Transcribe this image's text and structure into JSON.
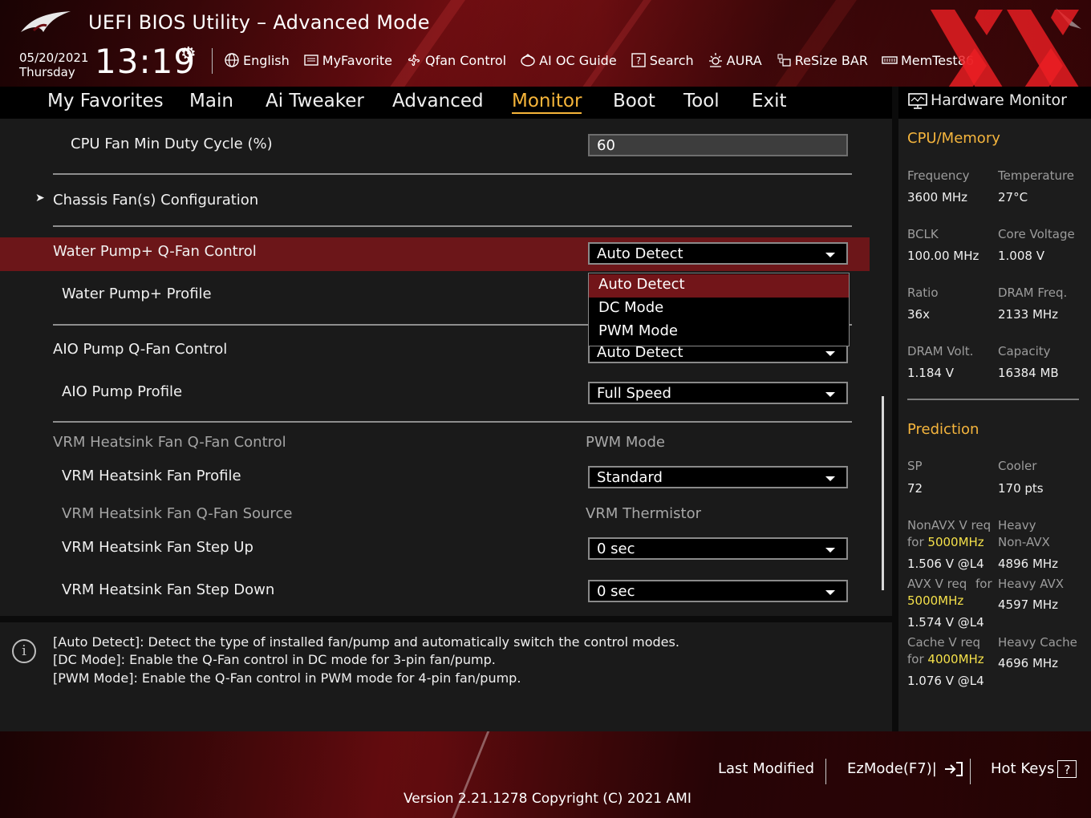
{
  "header": {
    "title": "UEFI BIOS Utility – Advanced Mode",
    "date": "05/20/2021",
    "weekday": "Thursday",
    "time": "13:19",
    "toolbar": [
      {
        "label": "English",
        "icon": "globe-icon"
      },
      {
        "label": "MyFavorite",
        "icon": "favorite-list-icon"
      },
      {
        "label": "Qfan Control",
        "icon": "fan-icon"
      },
      {
        "label": "AI OC Guide",
        "icon": "ai-oc-icon"
      },
      {
        "label": "Search",
        "icon": "search-question-icon"
      },
      {
        "label": "AURA",
        "icon": "aura-light-icon"
      },
      {
        "label": "ReSize BAR",
        "icon": "resize-bar-icon"
      },
      {
        "label": "MemTest86",
        "icon": "memtest-icon"
      }
    ]
  },
  "nav": {
    "tabs": [
      "My Favorites",
      "Main",
      "Ai Tweaker",
      "Advanced",
      "Monitor",
      "Boot",
      "Tool",
      "Exit"
    ],
    "active": "Monitor"
  },
  "settings": {
    "cpu_fan_min_duty": {
      "label": "CPU Fan Min Duty Cycle (%)",
      "value": "60"
    },
    "chassis_fans": {
      "label": "Chassis Fan(s) Configuration"
    },
    "water_pump_control": {
      "label": "Water Pump+ Q-Fan Control",
      "value": "Auto Detect"
    },
    "water_pump_profile": {
      "label": "Water Pump+ Profile"
    },
    "aio_pump_control": {
      "label": "AIO Pump Q-Fan Control",
      "value": "Auto Detect"
    },
    "aio_pump_profile": {
      "label": "AIO Pump Profile",
      "value": "Full Speed"
    },
    "vrm_control": {
      "label": "VRM Heatsink Fan Q-Fan Control",
      "value": "PWM Mode"
    },
    "vrm_profile": {
      "label": "VRM Heatsink Fan Profile",
      "value": "Standard"
    },
    "vrm_source": {
      "label": "VRM Heatsink Fan Q-Fan Source",
      "value": "VRM Thermistor"
    },
    "vrm_step_up": {
      "label": "VRM Heatsink Fan Step Up",
      "value": "0 sec"
    },
    "vrm_step_down": {
      "label": "VRM Heatsink Fan Step Down",
      "value": "0 sec"
    }
  },
  "dropdown": {
    "options": [
      "Auto Detect",
      "DC Mode",
      "PWM Mode"
    ],
    "selected": "Auto Detect"
  },
  "help": {
    "lines": [
      "[Auto Detect]: Detect the type of installed fan/pump and automatically switch the control modes.",
      "[DC Mode]: Enable the Q-Fan control in DC mode for 3-pin fan/pump.",
      "[PWM Mode]: Enable the Q-Fan control in PWM mode for 4-pin fan/pump."
    ]
  },
  "hardware_monitor": {
    "title": "Hardware Monitor",
    "cpu_memory": {
      "heading": "CPU/Memory",
      "frequency": {
        "label": "Frequency",
        "value": "3600 MHz"
      },
      "temperature": {
        "label": "Temperature",
        "value": "27°C"
      },
      "bclk": {
        "label": "BCLK",
        "value": "100.00 MHz"
      },
      "core_voltage": {
        "label": "Core Voltage",
        "value": "1.008 V"
      },
      "ratio": {
        "label": "Ratio",
        "value": "36x"
      },
      "dram_freq": {
        "label": "DRAM Freq.",
        "value": "2133 MHz"
      },
      "dram_volt": {
        "label": "DRAM Volt.",
        "value": "1.184 V"
      },
      "capacity": {
        "label": "Capacity",
        "value": "16384 MB"
      }
    },
    "prediction": {
      "heading": "Prediction",
      "sp": {
        "label": "SP",
        "value": "72"
      },
      "cooler": {
        "label": "Cooler",
        "value": "170 pts"
      },
      "nonavx": {
        "label_a": "NonAVX V req",
        "label_b": "for",
        "freq": "5000MHz",
        "value": "1.506 V @L4"
      },
      "heavy_nonavx": {
        "label_a": "Heavy",
        "label_b": "Non-AVX",
        "value": "4896 MHz"
      },
      "avx": {
        "label_a": "AVX V req",
        "label_for": "for",
        "freq": "5000MHz",
        "value": "1.574 V @L4"
      },
      "heavy_avx": {
        "label": "Heavy AVX",
        "value": "4597 MHz"
      },
      "cache": {
        "label_a": "Cache V req",
        "label_b": "for",
        "freq": "4000MHz",
        "value": "1.076 V @L4"
      },
      "heavy_cache": {
        "label": "Heavy Cache",
        "value": "4696 MHz"
      }
    }
  },
  "footer": {
    "last_modified": "Last Modified",
    "ezmode": "EzMode(F7)|",
    "hot_keys": "Hot Keys",
    "hot_keys_glyph": "?",
    "version": "Version 2.21.1278 Copyright (C) 2021 AMI"
  },
  "colors": {
    "accent": "#f6b53a",
    "highlight_row": "#6c1619",
    "yellow_freq": "#f4e04a"
  }
}
